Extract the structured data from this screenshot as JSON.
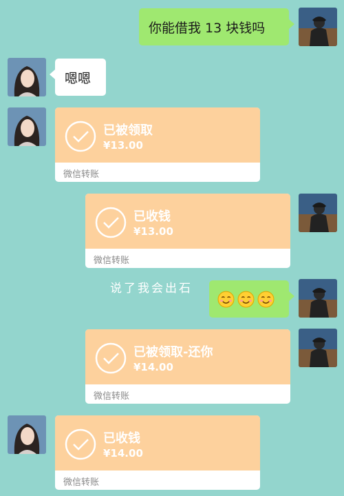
{
  "messages": {
    "m1": {
      "text": "你能借我 13 块钱吗"
    },
    "m2": {
      "text": "嗯嗯"
    },
    "m3": {
      "title": "已被领取",
      "amount": "¥13.00",
      "footer": "微信转账"
    },
    "m4": {
      "title": "已收钱",
      "amount": "¥13.00",
      "footer": "微信转账"
    },
    "m5": {
      "overlay": "说了我会出石",
      "emojis": [
        "smiling-face",
        "smiling-face",
        "smiling-face"
      ]
    },
    "m6": {
      "title": "已被领取-还你",
      "amount": "¥14.00",
      "footer": "微信转账"
    },
    "m7": {
      "title": "已收钱",
      "amount": "¥14.00",
      "footer": "微信转账"
    }
  },
  "colors": {
    "background": "#93d5cd",
    "sent_bubble": "#9fe870",
    "transfer_card": "#fdd19d"
  }
}
